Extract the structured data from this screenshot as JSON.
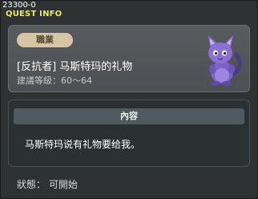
{
  "window": {
    "quest_id": "23300-0",
    "title": "QUEST INFO"
  },
  "info": {
    "job_tag": "職業",
    "quest_name": "[反抗者] 马斯特玛的礼物",
    "level_requirement": "建議等級：60～64",
    "npc_icon": "purple-cat-npc-icon"
  },
  "content": {
    "header": "內容",
    "description": "马斯特玛说有礼物要给我。"
  },
  "status": {
    "text": "狀態： 可開始"
  },
  "colors": {
    "title": "#e9ec59",
    "job_tag_bg": "#d7c6a6",
    "npc_purple": "#8a6fd6"
  }
}
